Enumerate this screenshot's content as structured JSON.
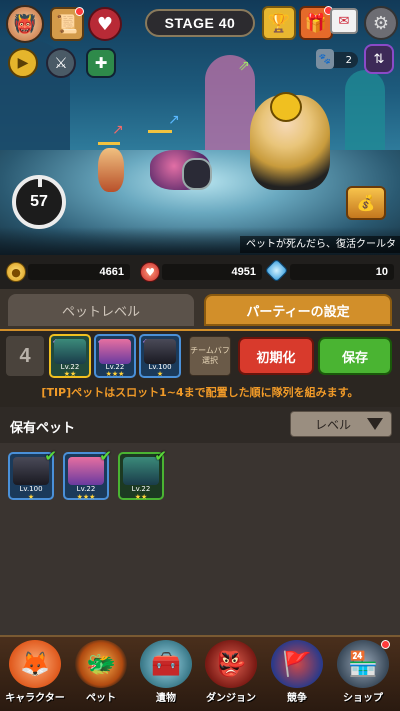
{
  "hud": {
    "stage_label": "STAGE 40",
    "pet_count": "2",
    "timer_value": "57",
    "ticker_text": "ペットが死んだら、復活クールタ"
  },
  "currency": {
    "gold": "4661",
    "hearts": "4951",
    "diamonds": "10"
  },
  "tabs": [
    {
      "label": "ペットレベル",
      "active": false
    },
    {
      "label": "パーティーの設定",
      "active": true
    }
  ],
  "party": {
    "slot_count": "4",
    "slots": [
      {
        "level": "Lv.22",
        "stars": "★★",
        "type": "ghost"
      },
      {
        "level": "Lv.22",
        "stars": "★★★",
        "type": "pig"
      },
      {
        "level": "Lv.100",
        "stars": "★",
        "type": "dark"
      }
    ],
    "team_buff_label": "チームバフ選択",
    "reset_label": "初期化",
    "save_label": "保存",
    "tip": "[TIP]ペットはスロット1~4まで配置した順に隊列を組みます。"
  },
  "owned": {
    "title": "保有ペット",
    "sort_value": "レベル",
    "pets": [
      {
        "level": "Lv.100",
        "stars": "★",
        "type": "dark"
      },
      {
        "level": "Lv.22",
        "stars": "★★★",
        "type": "pig"
      },
      {
        "level": "Lv.22",
        "stars": "★★",
        "type": "ghost"
      }
    ]
  },
  "nav": [
    {
      "label": "キャラクター",
      "icon": "character-icon"
    },
    {
      "label": "ペット",
      "icon": "pet-icon",
      "active": true
    },
    {
      "label": "遺物",
      "icon": "relic-chest-icon"
    },
    {
      "label": "ダンジョン",
      "icon": "dungeon-icon"
    },
    {
      "label": "競争",
      "icon": "pvp-banner-icon"
    },
    {
      "label": "ショップ",
      "icon": "shop-icon"
    }
  ]
}
